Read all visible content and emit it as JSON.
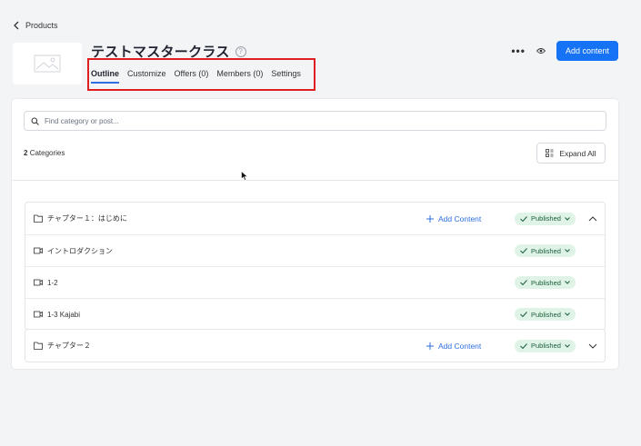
{
  "back_link": "Products",
  "product": {
    "title": "テストマスタークラス",
    "help": "?"
  },
  "tabs": [
    {
      "label": "Outline",
      "active": true
    },
    {
      "label": "Customize",
      "active": false
    },
    {
      "label": "Offers (0)",
      "active": false
    },
    {
      "label": "Members (0)",
      "active": false
    },
    {
      "label": "Settings",
      "active": false
    }
  ],
  "actions": {
    "more": "•••",
    "add_content": "Add content"
  },
  "search": {
    "placeholder": "Find category or post..."
  },
  "categories": {
    "count": "2",
    "label": "Categories"
  },
  "expand_all": "Expand All",
  "chapter1": {
    "title": "チャプター１：はじめに",
    "add": "Add Content",
    "status": "Published",
    "lessons": [
      {
        "title": "イントロダクション",
        "status": "Published"
      },
      {
        "title": "1-2",
        "status": "Published"
      },
      {
        "title": "1-3 Kajabi",
        "status": "Published"
      }
    ]
  },
  "chapter2": {
    "title": "チャプター２",
    "add": "Add Content",
    "status": "Published"
  },
  "colors": {
    "accent": "#1673f5",
    "highlight_box": "#e02020",
    "published_bg": "#dff3e6"
  }
}
